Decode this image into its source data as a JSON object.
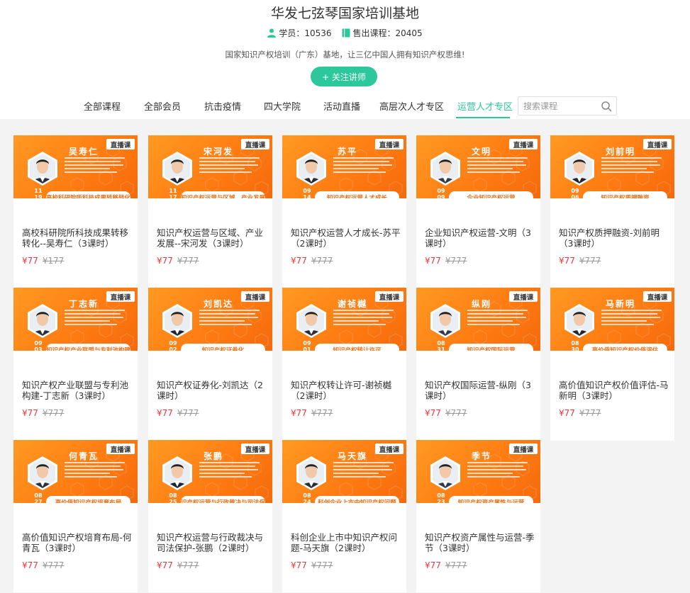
{
  "header": {
    "title": "华发七弦琴国家培训基地",
    "students_label": "学员：10536",
    "courses_label": "售出课程：20405",
    "slogan": "国家知识产权培训（广东）基地，让三亿中国人拥有知识产权思维!",
    "follow_button": "+ 关注讲师",
    "accent_color": "#2cc79a"
  },
  "nav": {
    "tabs": [
      "全部课程",
      "全部会员",
      "抗击疫情",
      "四大学院",
      "活动直播",
      "高层次人才专区",
      "运营人才专区"
    ],
    "active_tab": "运营人才专区",
    "search_placeholder": "搜索课程",
    "search_icon": "search-icon"
  },
  "courses": [
    {
      "teacher": "吴寿仁",
      "date": "11 / 19",
      "topic": "高校科研院所科技成果转移转化",
      "title": "高校科研院所科技成果转移转化--吴寿仁（3课时）",
      "price": "¥77",
      "original_price": "¥177",
      "badge": "直播课"
    },
    {
      "teacher": "宋河发",
      "date": "11 / 17",
      "topic": "知识产权运营与区域、产业发展",
      "title": "知识产权运营与区域、产业发展--宋河发（3课时）",
      "price": "¥77",
      "original_price": "¥777",
      "badge": "直播课"
    },
    {
      "teacher": "苏平",
      "date": "09 / 14",
      "topic": "知识产权运营人才成长",
      "title": "知识产权运营人才成长-苏平（2课时）",
      "price": "¥77",
      "original_price": "¥777",
      "badge": "直播课"
    },
    {
      "teacher": "文明",
      "date": "09 / 09",
      "topic": "企业知识产权运营",
      "title": "企业知识产权运营-文明（3课时）",
      "price": "¥77",
      "original_price": "¥777",
      "badge": "直播课"
    },
    {
      "teacher": "刘前明",
      "date": "09 / 06",
      "topic": "知识产权质押融资",
      "title": "知识产权质押融资-刘前明（3课时）",
      "price": "¥77",
      "original_price": "¥777",
      "badge": "直播课"
    },
    {
      "teacher": "丁志新",
      "date": "09 / 03",
      "topic": "知识产权产业联盟与专利池构建",
      "title": "知识产权产业联盟与专利池构建-丁志新（3课时）",
      "price": "¥77",
      "original_price": "¥777",
      "badge": "直播课"
    },
    {
      "teacher": "刘凯达",
      "date": "09 / 02",
      "topic": "知识产权证券化",
      "title": "知识产权证券化-刘凯达（2课时）",
      "price": "¥77",
      "original_price": "¥777",
      "badge": "直播课"
    },
    {
      "teacher": "谢祯樾",
      "date": "09 / 01",
      "topic": "知识产权转让许可",
      "title": "知识产权转让许可-谢祯樾（2课时）",
      "price": "¥77",
      "original_price": "¥777",
      "badge": "直播课"
    },
    {
      "teacher": "纵刚",
      "date": "08 / 31",
      "topic": "知识产权国际运营",
      "title": "知识产权国际运营-纵刚（3课时）",
      "price": "¥77",
      "original_price": "¥777",
      "badge": "直播课"
    },
    {
      "teacher": "马新明",
      "date": "08 / 30",
      "topic": "高价值知识产权价值评估",
      "title": "高价值知识产权价值评估-马新明（3课时）",
      "price": "¥77",
      "original_price": "¥777",
      "badge": "直播课"
    },
    {
      "teacher": "何青瓦",
      "date": "08 / 27",
      "topic": "高价值知识产权培育布局",
      "title": "高价值知识产权培育布局-何青瓦（3课时）",
      "price": "¥77",
      "original_price": "¥777",
      "badge": "直播课"
    },
    {
      "teacher": "张鹏",
      "date": "08 / 25",
      "topic": "知识产权运营与行政裁决与司法保护",
      "title": "知识产权运营与行政裁决与司法保护-张鹏（2课时）",
      "price": "¥77",
      "original_price": "¥777",
      "badge": "直播课"
    },
    {
      "teacher": "马天旗",
      "date": "08 / 24",
      "topic": "科创企业上市中知识产权问题",
      "title": "科创企业上市中知识产权问题-马天旗（2课时）",
      "price": "¥77",
      "original_price": "¥777",
      "badge": "直播课"
    },
    {
      "teacher": "季节",
      "date": "08 / 23",
      "topic": "知识产权资产属性与运营",
      "title": "知识产权资产属性与运营-季节（3课时）",
      "price": "¥77",
      "original_price": "¥777",
      "badge": "直播课"
    }
  ]
}
